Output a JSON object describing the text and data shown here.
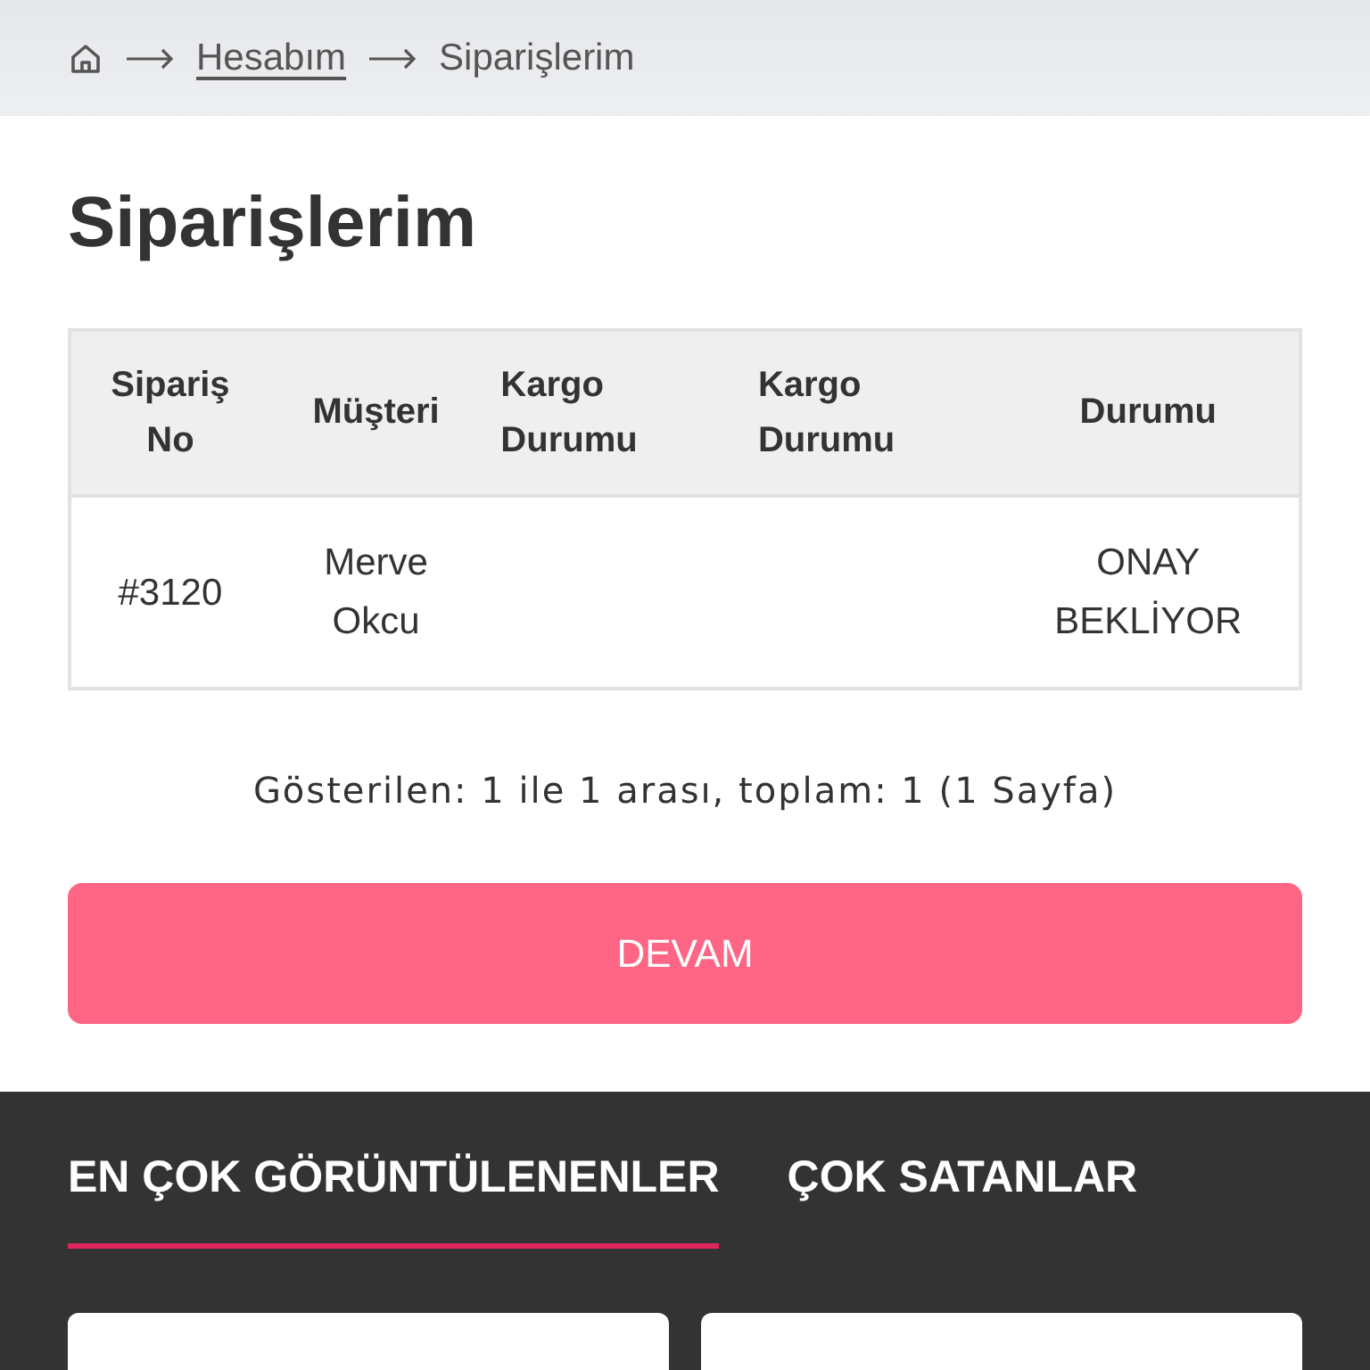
{
  "breadcrumb": {
    "items": [
      {
        "label": "Hesabım",
        "kind": "link"
      },
      {
        "label": "Siparişlerim",
        "kind": "current"
      }
    ]
  },
  "title": "Siparişlerim",
  "table": {
    "columns": [
      "Sipariş No",
      "Müşteri",
      "Kargo Durumu",
      "Kargo Durumu",
      "Durumu"
    ],
    "rows": [
      [
        "#3120",
        "Merve Okcu",
        "",
        "",
        "ONAY BEKLİYOR"
      ]
    ]
  },
  "pagination": "Gösterilen: 1 ile 1 arası, toplam: 1 (1 Sayfa)",
  "continue_button": "DEVAM",
  "product_tabs": [
    {
      "label": "EN ÇOK GÖRÜNTÜLENENLER",
      "selected": true
    },
    {
      "label": "ÇOK SATANLAR",
      "selected": false
    }
  ],
  "product_cards": [
    {
      "kind": "product"
    },
    {
      "kind": "product"
    }
  ]
}
